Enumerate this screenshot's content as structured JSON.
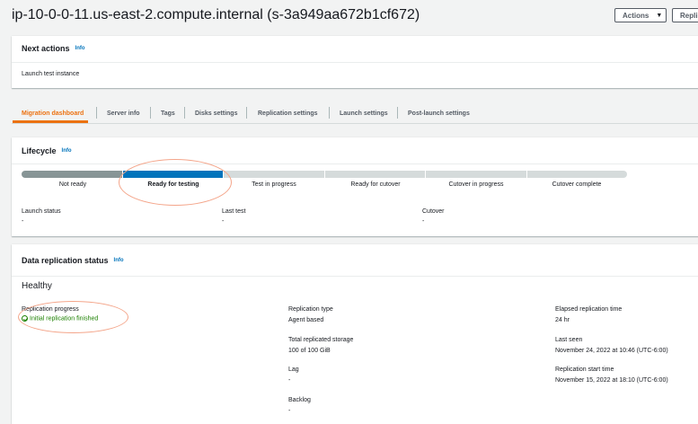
{
  "header": {
    "title": "ip-10-0-0-11.us-east-2.compute.internal (s-3a949aa672b1cf672)",
    "actions_label": "Actions",
    "replicate_label": "Repli"
  },
  "next_actions": {
    "title": "Next actions",
    "info": "Info",
    "text": "Launch test instance"
  },
  "tabs": [
    {
      "label": "Migration dashboard",
      "active": true
    },
    {
      "label": "Server info"
    },
    {
      "label": "Tags"
    },
    {
      "label": "Disks settings"
    },
    {
      "label": "Replication settings"
    },
    {
      "label": "Launch settings"
    },
    {
      "label": "Post-launch settings"
    }
  ],
  "lifecycle": {
    "title": "Lifecycle",
    "info": "Info",
    "steps": [
      {
        "label": "Not ready",
        "state": "done"
      },
      {
        "label": "Ready for testing",
        "state": "current"
      },
      {
        "label": "Test in progress",
        "state": "pending"
      },
      {
        "label": "Ready for cutover",
        "state": "pending"
      },
      {
        "label": "Cutover in progress",
        "state": "pending"
      },
      {
        "label": "Cutover complete",
        "state": "pending"
      }
    ],
    "fields": [
      {
        "label": "Launch status",
        "value": "-"
      },
      {
        "label": "Last test",
        "value": "-"
      },
      {
        "label": "Cutover",
        "value": "-"
      }
    ]
  },
  "replication": {
    "title": "Data replication status",
    "info": "Info",
    "health": "Healthy",
    "progress_label": "Replication progress",
    "progress_value": "Initial replication finished",
    "type_label": "Replication type",
    "type_value": "Agent based",
    "storage_label": "Total replicated storage",
    "storage_value": "100 of 100 GiB",
    "lag_label": "Lag",
    "lag_value": "-",
    "backlog_label": "Backlog",
    "backlog_value": "-",
    "elapsed_label": "Elapsed replication time",
    "elapsed_value": "24 hr",
    "last_seen_label": "Last seen",
    "last_seen_value": "November 24, 2022 at 10:46 (UTC-6:00)",
    "start_label": "Replication start time",
    "start_value": "November 15, 2022 at 18:10 (UTC-6:00)"
  },
  "colors": {
    "accent": "#ec7211",
    "link": "#0073bb",
    "done": "#879596",
    "current": "#0073bb",
    "pending": "#d5dbdb",
    "success": "#1d8102",
    "annotation": "#f4a58a"
  }
}
